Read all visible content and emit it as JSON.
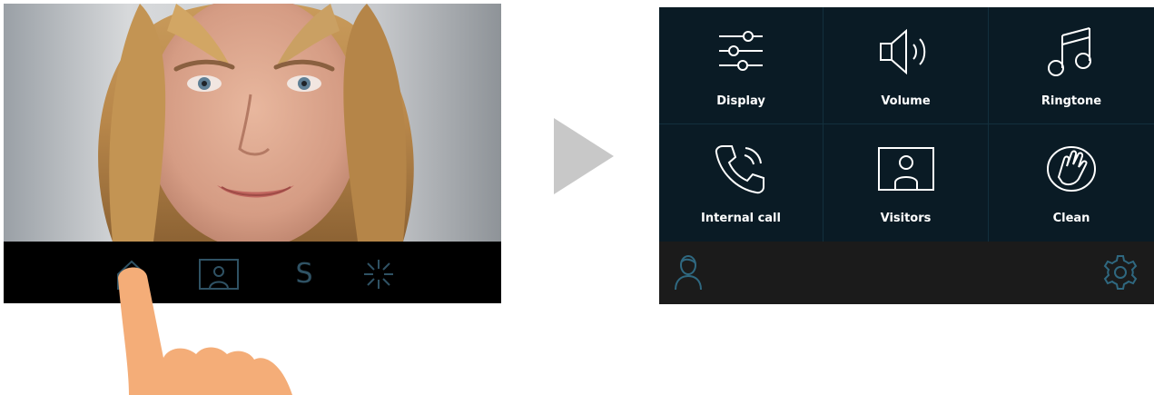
{
  "video_panel": {
    "toolbar": {
      "home_icon": "home-icon",
      "visitors_icon": "visitor-photo-icon",
      "s_label": "S",
      "light_icon": "light-icon"
    }
  },
  "transition_icon": "play-arrow-icon",
  "menu": {
    "items": [
      {
        "label": "Display",
        "icon": "sliders-icon"
      },
      {
        "label": "Volume",
        "icon": "speaker-icon"
      },
      {
        "label": "Ringtone",
        "icon": "music-note-icon"
      },
      {
        "label": "Internal call",
        "icon": "phone-call-icon"
      },
      {
        "label": "Visitors",
        "icon": "visitor-photo-icon"
      },
      {
        "label": "Clean",
        "icon": "hand-clean-icon"
      }
    ],
    "bottom": {
      "left_icon": "user-icon",
      "right_icon": "gear-icon"
    }
  },
  "colors": {
    "menu_background": "#0a1b25",
    "menu_bottom_bar": "#1b1b1b",
    "toolbar_icon": "#2f5264",
    "bottom_icon": "#2f6880",
    "hand_skin": "#f4ad78",
    "arrow": "#c8c8c8"
  }
}
